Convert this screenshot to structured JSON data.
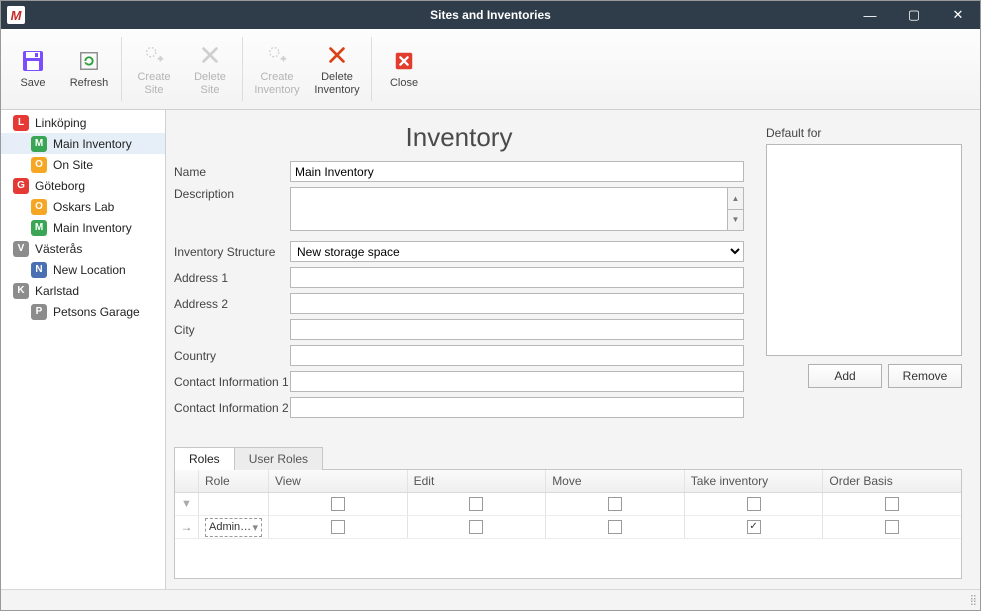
{
  "window": {
    "title": "Sites and Inventories"
  },
  "toolbar": {
    "save": "Save",
    "refresh": "Refresh",
    "create_site": "Create\nSite",
    "delete_site": "Delete\nSite",
    "create_inventory": "Create\nInventory",
    "delete_inventory": "Delete\nInventory",
    "close": "Close"
  },
  "tree": [
    {
      "depth": 0,
      "badge": "L",
      "color": "#e53935",
      "label": "Linköping"
    },
    {
      "depth": 1,
      "badge": "M",
      "color": "#3aa655",
      "label": "Main Inventory",
      "selected": true
    },
    {
      "depth": 1,
      "badge": "O",
      "color": "#f5a623",
      "label": "On Site"
    },
    {
      "depth": 0,
      "badge": "G",
      "color": "#e53935",
      "label": "Göteborg"
    },
    {
      "depth": 1,
      "badge": "O",
      "color": "#f5a623",
      "label": "Oskars Lab"
    },
    {
      "depth": 1,
      "badge": "M",
      "color": "#3aa655",
      "label": "Main Inventory"
    },
    {
      "depth": 0,
      "badge": "V",
      "color": "#8c8c8c",
      "label": "Västerås"
    },
    {
      "depth": 1,
      "badge": "N",
      "color": "#4a6fb3",
      "label": "New Location"
    },
    {
      "depth": 0,
      "badge": "K",
      "color": "#8c8c8c",
      "label": "Karlstad"
    },
    {
      "depth": 1,
      "badge": "P",
      "color": "#8c8c8c",
      "label": "Petsons Garage"
    }
  ],
  "page": {
    "title": "Inventory"
  },
  "form": {
    "name_label": "Name",
    "name_value": "Main Inventory",
    "description_label": "Description",
    "description_value": "",
    "structure_label": "Inventory Structure",
    "structure_value": "New storage space",
    "address1_label": "Address 1",
    "address1_value": "",
    "address2_label": "Address 2",
    "address2_value": "",
    "city_label": "City",
    "city_value": "",
    "country_label": "Country",
    "country_value": "",
    "contact1_label": "Contact Information 1",
    "contact1_value": "",
    "contact2_label": "Contact Information 2",
    "contact2_value": ""
  },
  "default_for": {
    "label": "Default for",
    "add": "Add",
    "remove": "Remove"
  },
  "tabs": {
    "roles": "Roles",
    "user_roles": "User Roles"
  },
  "grid": {
    "headers": {
      "role": "Role",
      "view": "View",
      "edit": "Edit",
      "move": "Move",
      "take": "Take inventory",
      "order": "Order Basis"
    },
    "rows": [
      {
        "role_display": "Admin…",
        "view": false,
        "edit": false,
        "move": false,
        "take": true,
        "order": false
      }
    ]
  }
}
